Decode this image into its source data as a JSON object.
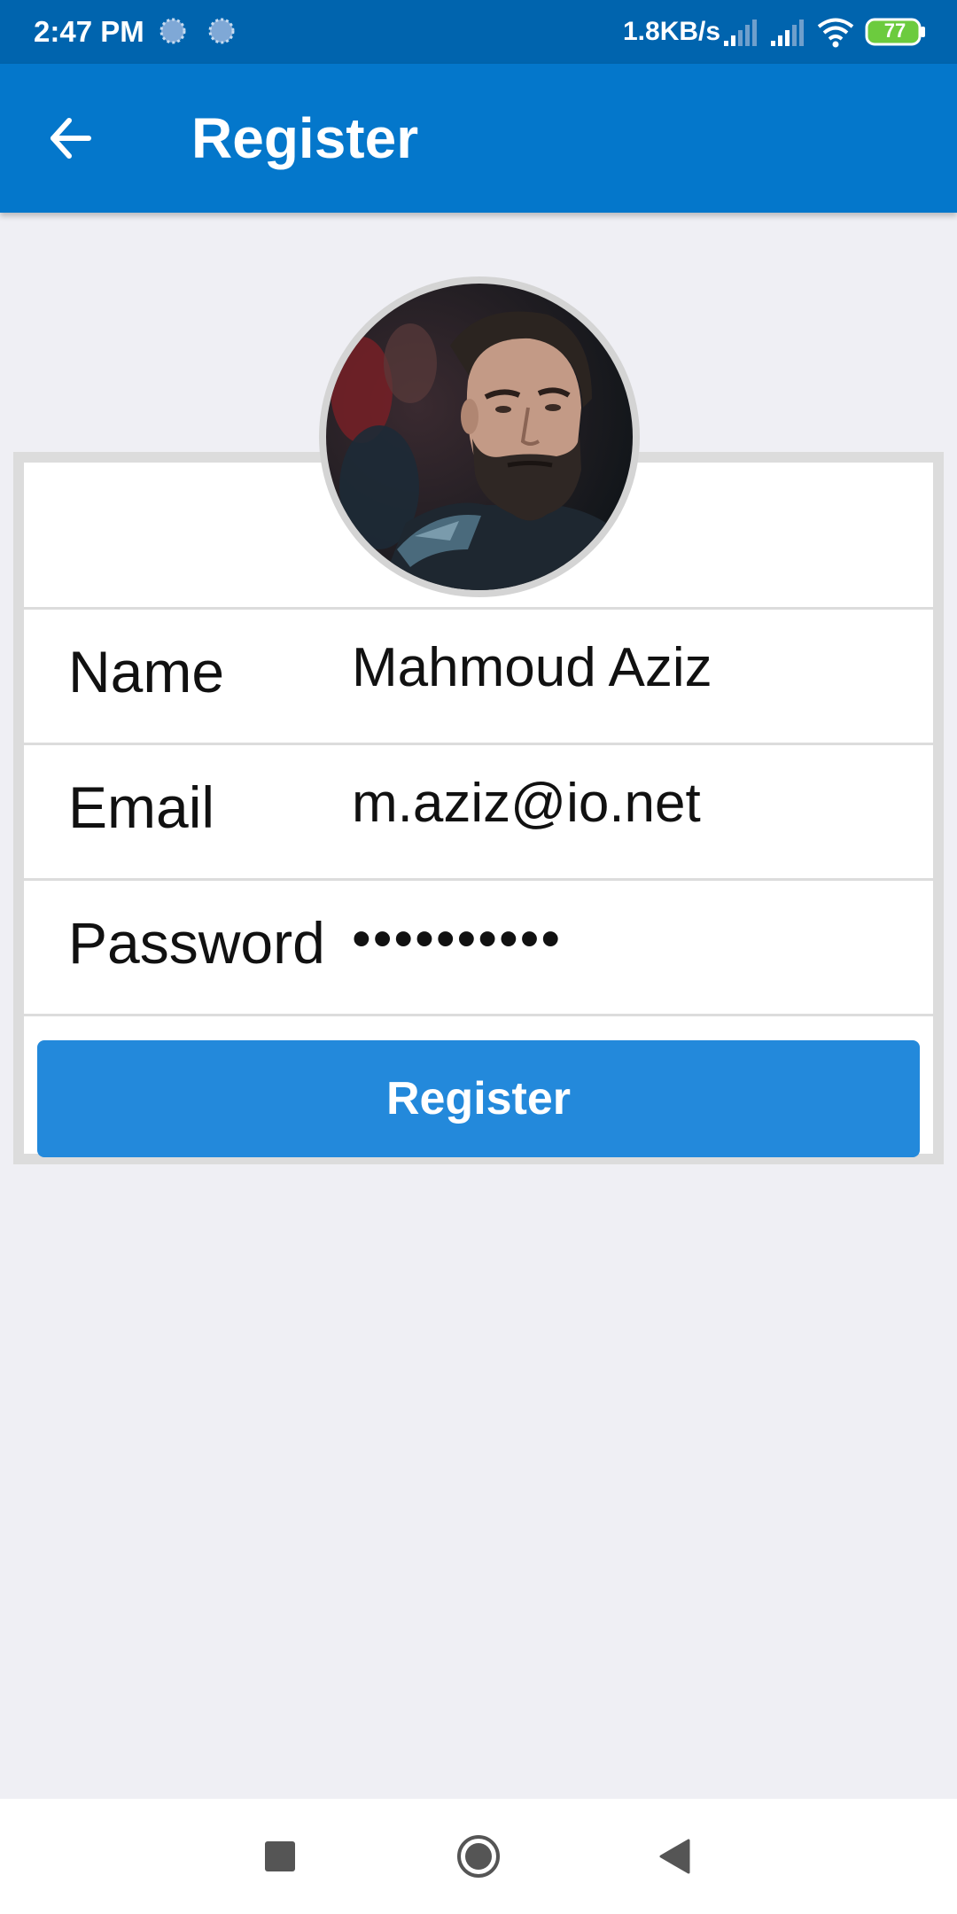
{
  "status_bar": {
    "time": "2:47 PM",
    "network_speed": "1.8KB/s",
    "battery_level": "77",
    "icons": [
      "loading-dot-icon",
      "loading-dot-icon",
      "signal-icon",
      "signal-icon",
      "wifi-icon",
      "battery-icon"
    ]
  },
  "app_bar": {
    "title": "Register",
    "back_icon": "arrow-left-icon"
  },
  "form": {
    "fields": [
      {
        "label": "Name",
        "value": "Mahmoud Aziz"
      },
      {
        "label": "Email",
        "value": "m.aziz@io.net"
      },
      {
        "label": "Password",
        "value": "••••••••••"
      }
    ],
    "submit_label": "Register"
  },
  "nav_bar": {
    "icons": [
      "recent-apps-icon",
      "home-icon",
      "back-icon"
    ]
  },
  "colors": {
    "status_bar": "#0064ae",
    "app_bar": "#0477cb",
    "button": "#2389db",
    "background": "#efeff4"
  }
}
